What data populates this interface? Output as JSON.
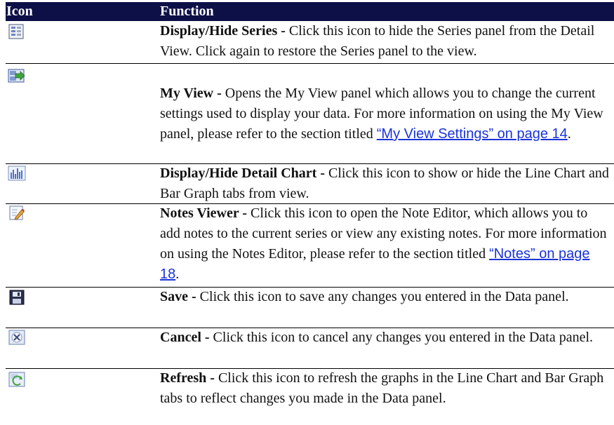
{
  "header": {
    "icon_label": "Icon",
    "function_label": "Function"
  },
  "rows": [
    {
      "icon": "display-hide-series-icon",
      "title": "Display/Hide Series -",
      "desc": " Click this icon to hide the Series panel from the Detail View. Click again to restore the Series panel to the view.",
      "link": "",
      "suffix": ""
    },
    {
      "icon": "my-view-icon",
      "title": "My View -",
      "desc": " Opens the My View panel which allows you to change the current settings used to display your data. For more information on using the My View panel, please refer to the section titled ",
      "link": "“My View Settings” on page 14",
      "suffix": "."
    },
    {
      "icon": "display-hide-detail-chart-icon",
      "title": "Display/Hide Detail Chart -",
      "desc": " Click this icon to show or hide the Line Chart and Bar Graph tabs from view.",
      "link": "",
      "suffix": ""
    },
    {
      "icon": "notes-viewer-icon",
      "title": "Notes Viewer -",
      "desc": " Click this icon to open the Note Editor, which allows you to add notes to the current series or view any existing notes. For more information on using the Notes Editor, please refer to the section titled ",
      "link": "“Notes” on page 18",
      "suffix": "."
    },
    {
      "icon": "save-icon",
      "title": "Save -",
      "desc": " Click this icon to save any changes you entered in the Data panel.",
      "link": "",
      "suffix": ""
    },
    {
      "icon": "cancel-icon",
      "title": "Cancel -",
      "desc": " Click this icon to cancel any changes you entered in the Data panel.",
      "link": "",
      "suffix": ""
    },
    {
      "icon": "refresh-icon",
      "title": "Refresh -",
      "desc": " Click this icon to refresh the graphs in the Line Chart and Bar Graph tabs to reflect changes you made in the Data panel.",
      "link": "",
      "suffix": ""
    }
  ]
}
